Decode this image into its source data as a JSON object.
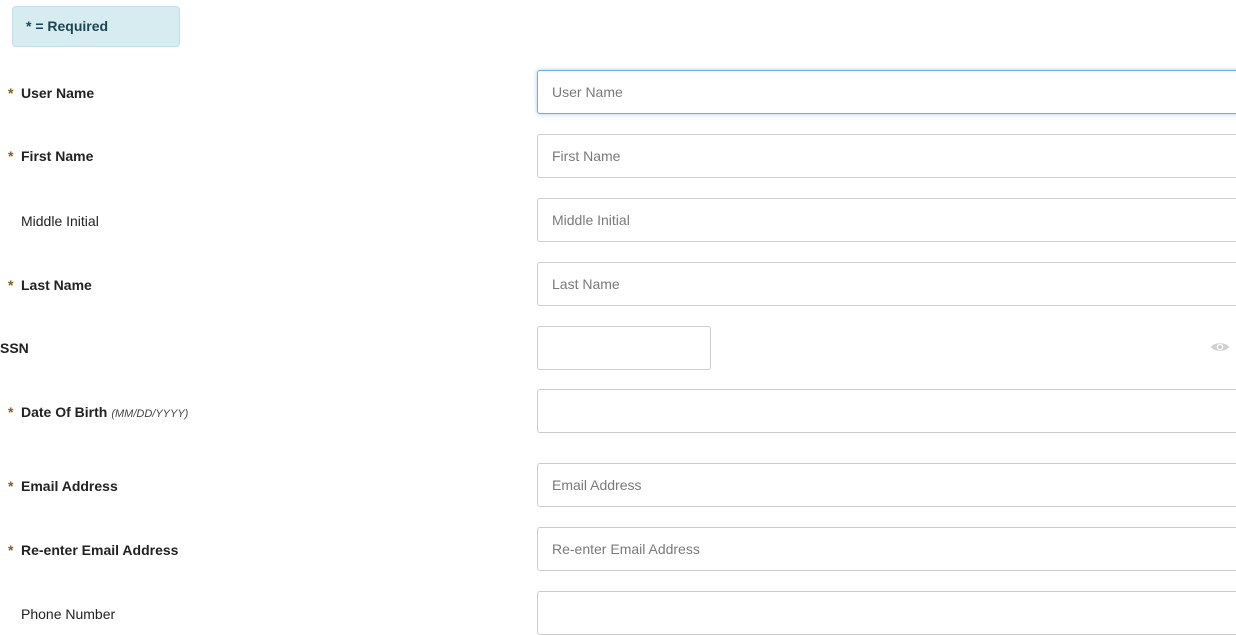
{
  "badge": {
    "star": "*",
    "text": " = Required"
  },
  "fields": {
    "user_name": {
      "label": "User Name",
      "star": "*",
      "placeholder": "User Name"
    },
    "first_name": {
      "label": "First Name",
      "star": "*",
      "placeholder": "First Name"
    },
    "middle_initial": {
      "label": "Middle Initial",
      "placeholder": "Middle Initial"
    },
    "last_name": {
      "label": "Last Name",
      "star": "*",
      "placeholder": "Last Name"
    },
    "ssn": {
      "label": "SSN",
      "placeholder": ""
    },
    "dob": {
      "label": "Date Of Birth",
      "hint": "(MM/DD/YYYY)",
      "star": "*",
      "placeholder": ""
    },
    "email": {
      "label": "Email Address",
      "star": "*",
      "placeholder": "Email Address"
    },
    "email_confirm": {
      "label": "Re-enter Email Address",
      "star": "*",
      "placeholder": "Re-enter Email Address"
    },
    "phone": {
      "label": "Phone Number",
      "placeholder": ""
    }
  },
  "icons": {
    "ssn_toggle": "eye-icon"
  },
  "colors": {
    "badge_bg": "#d6ecf1",
    "focus_border": "#66afe9",
    "required_star": "#8a5a1e"
  }
}
